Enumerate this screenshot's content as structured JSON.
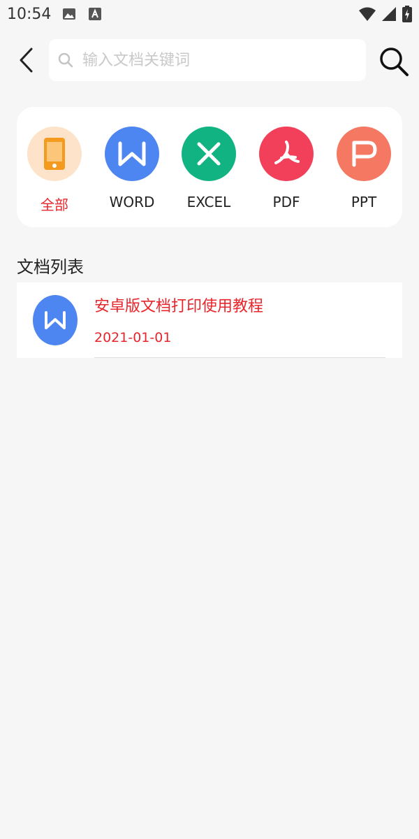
{
  "status_bar": {
    "time": "10:54",
    "icons": [
      "image-icon",
      "font-icon",
      "wifi-icon",
      "signal-icon",
      "battery-icon"
    ]
  },
  "header": {
    "search_placeholder": "输入文档关键词",
    "search_value": ""
  },
  "categories": [
    {
      "label": "全部",
      "icon": "phone-icon",
      "color": "#fde3c9",
      "icon_color": "#f39a1f",
      "active": true
    },
    {
      "label": "WORD",
      "icon": "word-icon",
      "color": "#4d86f0",
      "active": false
    },
    {
      "label": "EXCEL",
      "icon": "excel-icon",
      "color": "#12b383",
      "active": false
    },
    {
      "label": "PDF",
      "icon": "pdf-icon",
      "color": "#f2405a",
      "active": false
    },
    {
      "label": "PPT",
      "icon": "ppt-icon",
      "color": "#f47862",
      "active": false
    }
  ],
  "section": {
    "title": "文档列表"
  },
  "documents": [
    {
      "title": "安卓版文档打印使用教程",
      "date": "2021-01-01",
      "type_icon": "word-icon"
    }
  ],
  "colors": {
    "accent_red": "#e8252b",
    "background": "#f6f6f6"
  }
}
